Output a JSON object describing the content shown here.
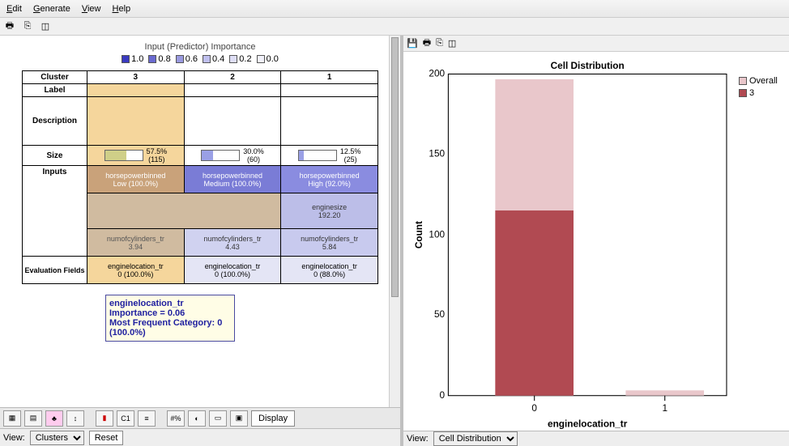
{
  "menus": {
    "edit": "Edit",
    "generate": "Generate",
    "view": "View",
    "help": "Help"
  },
  "legend": {
    "title": "Input (Predictor) Importance",
    "items": [
      "1.0",
      "0.8",
      "0.6",
      "0.4",
      "0.2",
      "0.0"
    ]
  },
  "clusterTable": {
    "headers": {
      "cluster": "Cluster",
      "c3": "3",
      "c2": "2",
      "c1": "1"
    },
    "rows": {
      "label": "Label",
      "description": "Description",
      "size": "Size",
      "inputs": "Inputs",
      "evaluation": "Evaluation Fields"
    },
    "sizes": {
      "c3": "57.5%\n(115)",
      "c2": "30.0%\n(60)",
      "c1": "12.5%\n(25)"
    },
    "inputsRow1": {
      "c3": "horsepowerbinned\nLow (100.0%)",
      "c2": "horsepowerbinned\nMedium (100.0%)",
      "c1": "horsepowerbinned\nHigh (92.0%)"
    },
    "inputsRow2": {
      "c2": "",
      "c1": "enginesize\n192.20"
    },
    "inputsRow3": {
      "c3": "numofcylinders_tr\n3.94",
      "c2": "numofcylinders_tr\n4.43",
      "c1": "numofcylinders_tr\n5.84"
    },
    "evalRow": {
      "c3": "enginelocation_tr\n0 (100.0%)",
      "c2": "enginelocation_tr\n0 (100.0%)",
      "c1": "enginelocation_tr\n0 (88.0%)"
    }
  },
  "tooltip": {
    "l1": "enginelocation_tr",
    "l2": "Importance = 0.06",
    "l3": "Most Frequent Category: 0",
    "l4": "(100.0%)"
  },
  "bottom": {
    "display": "Display",
    "reset": "Reset",
    "viewLabelLeft": "View:",
    "viewSelectLeft": "Clusters",
    "viewLabelRight": "View:",
    "viewSelectRight": "Cell Distribution"
  },
  "chart_data": {
    "type": "bar",
    "title": "Cell Distribution",
    "xlabel": "enginelocation_tr",
    "ylabel": "Count",
    "ylim": [
      0,
      200
    ],
    "yticks": [
      0,
      50,
      100,
      150,
      200
    ],
    "categories": [
      "0",
      "1"
    ],
    "series": [
      {
        "name": "Overall",
        "values": [
          197,
          3
        ],
        "color": "#e9c7cb"
      },
      {
        "name": "3",
        "values": [
          115,
          0
        ],
        "color": "#b14a52"
      }
    ]
  }
}
